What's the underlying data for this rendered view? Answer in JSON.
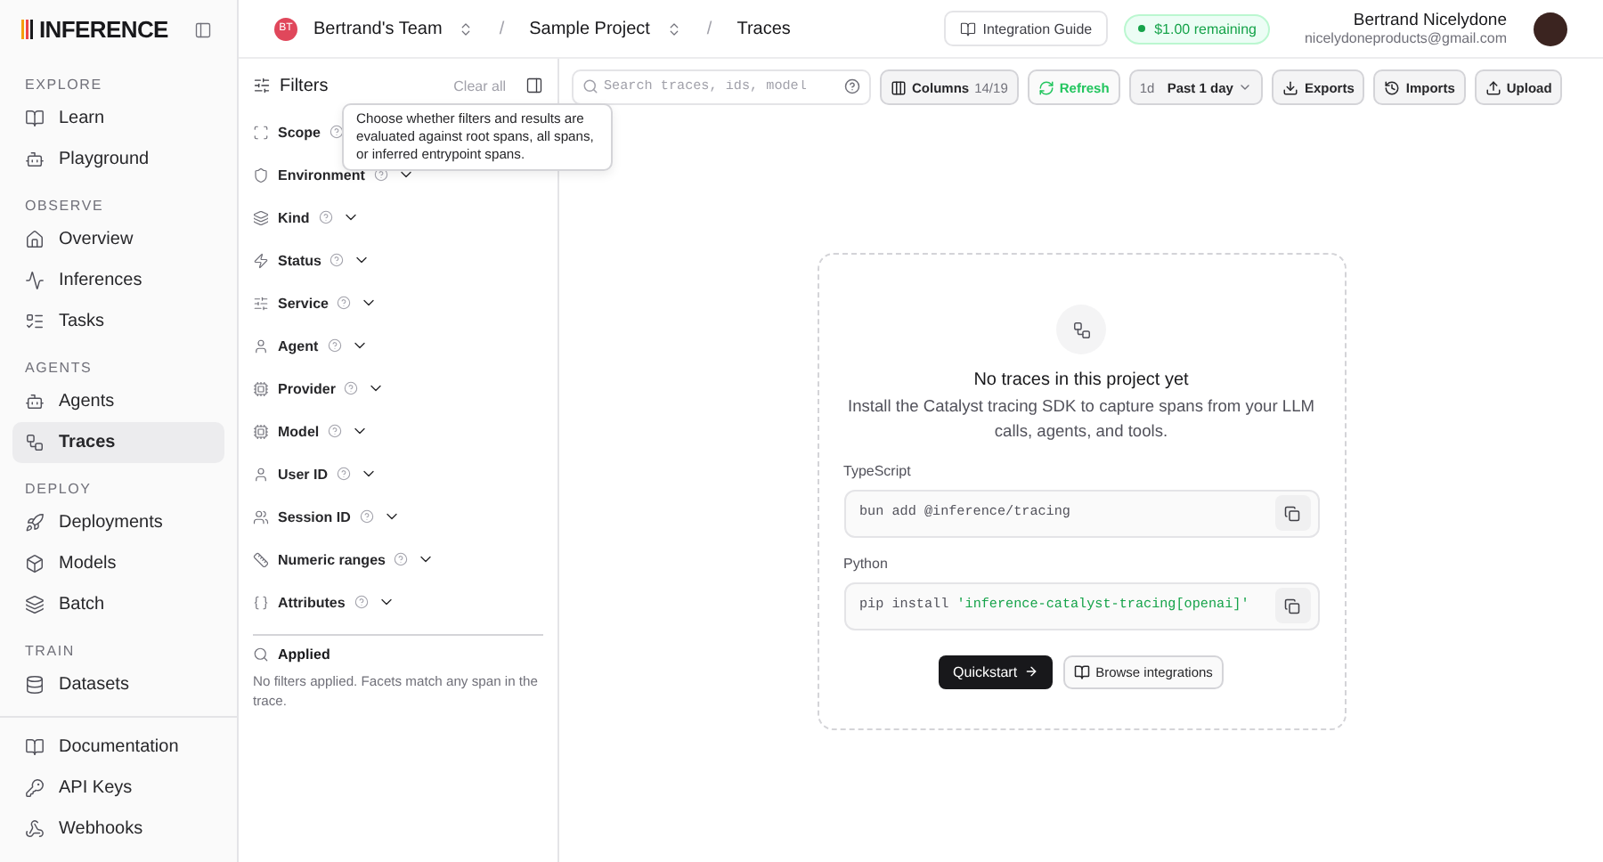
{
  "sidebar": {
    "logo": "INFERENCE",
    "sections": [
      {
        "label": "EXPLORE",
        "items": [
          {
            "label": "Learn",
            "selected": false
          },
          {
            "label": "Playground",
            "selected": false
          }
        ]
      },
      {
        "label": "OBSERVE",
        "items": [
          {
            "label": "Overview",
            "selected": false
          },
          {
            "label": "Inferences",
            "selected": false
          },
          {
            "label": "Tasks",
            "selected": false
          }
        ]
      },
      {
        "label": "AGENTS",
        "items": [
          {
            "label": "Agents",
            "selected": false
          },
          {
            "label": "Traces",
            "selected": true
          }
        ]
      },
      {
        "label": "DEPLOY",
        "items": [
          {
            "label": "Deployments",
            "selected": false
          },
          {
            "label": "Models",
            "selected": false
          },
          {
            "label": "Batch",
            "selected": false
          }
        ]
      },
      {
        "label": "TRAIN",
        "items": [
          {
            "label": "Datasets",
            "selected": false
          }
        ]
      }
    ],
    "footer_items": [
      {
        "label": "Documentation",
        "selected": false
      },
      {
        "label": "API Keys",
        "selected": false
      },
      {
        "label": "Webhooks",
        "selected": false
      }
    ]
  },
  "header": {
    "team": {
      "initials": "BT",
      "name": "Bertrand's Team"
    },
    "separator": "/",
    "project": "Sample Project",
    "page": "Traces",
    "guide_button": "Integration Guide",
    "balance": "$1.00 remaining",
    "user": {
      "name": "Bertrand Nicelydone",
      "email": "nicelydoneproducts@gmail.com"
    }
  },
  "filters": {
    "title": "Filters",
    "clear": "Clear all",
    "facets": [
      {
        "label": "Scope"
      },
      {
        "label": "Environment"
      },
      {
        "label": "Kind"
      },
      {
        "label": "Status"
      },
      {
        "label": "Service"
      },
      {
        "label": "Agent"
      },
      {
        "label": "Provider"
      },
      {
        "label": "Model"
      },
      {
        "label": "User ID"
      },
      {
        "label": "Session ID"
      },
      {
        "label": "Numeric ranges"
      },
      {
        "label": "Attributes"
      }
    ],
    "tooltip": "Choose whether filters and results are evaluated against root spans, all spans, or inferred entrypoint spans.",
    "applied": {
      "title": "Applied",
      "text": "No filters applied. Facets match any span in the trace."
    }
  },
  "toolbar": {
    "search": {
      "placeholder": "Search traces, ids, model"
    },
    "columns": {
      "label": "Columns",
      "count": "14/19"
    },
    "refresh": "Refresh",
    "range": {
      "short": "1d",
      "label": "Past 1 day"
    },
    "exports": "Exports",
    "imports": "Imports",
    "upload": "Upload"
  },
  "empty_state": {
    "title": "No traces in this project yet",
    "text": "Install the Catalyst tracing SDK to capture spans from your LLM calls, agents, and tools.",
    "snippets": [
      {
        "label": "TypeScript",
        "command": "bun add @inference/tracing"
      },
      {
        "label": "Python",
        "command": "pip install",
        "argument": "'inference-catalyst-tracing[openai]'"
      }
    ],
    "primary_button": "Quickstart",
    "secondary_button": "Browse integrations"
  }
}
